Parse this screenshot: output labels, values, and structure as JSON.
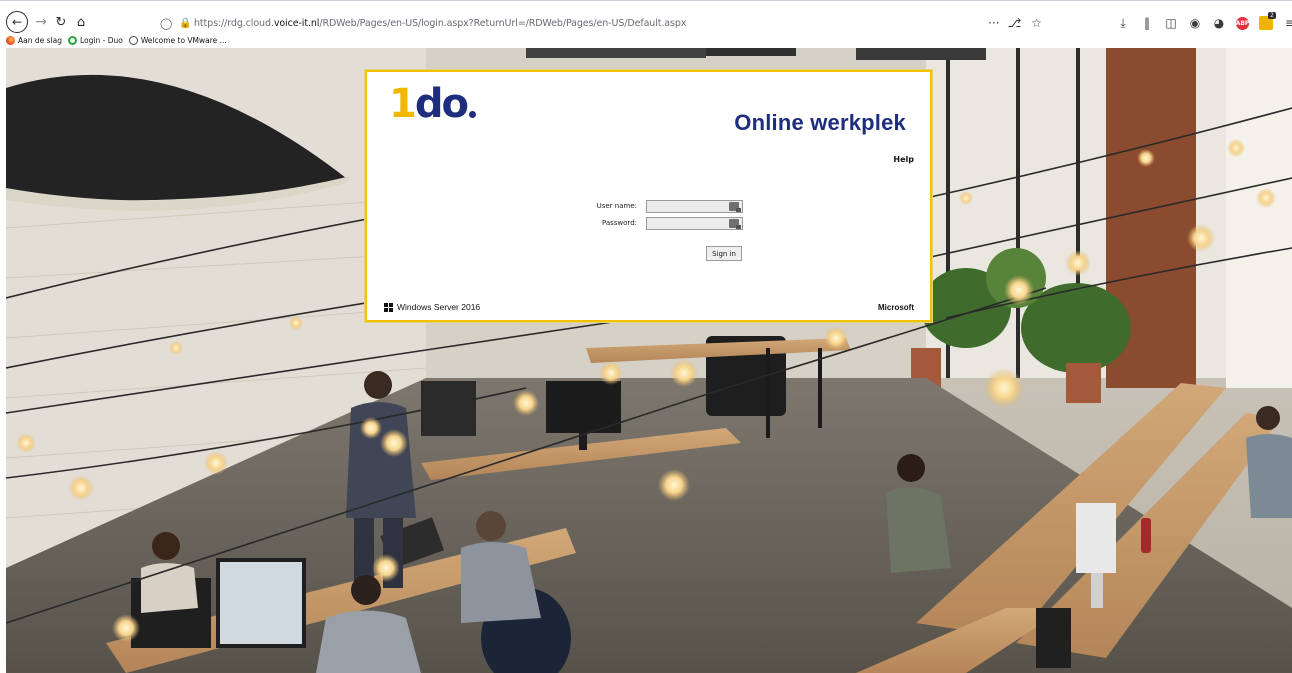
{
  "browser": {
    "url_prefix": "https://rdg.cloud.",
    "url_domain": "voice-it.nl",
    "url_suffix": "/RDWeb/Pages/en-US/login.aspx?ReturnUrl=/RDWeb/Pages/en-US/Default.aspx",
    "page_actions": "···",
    "extension_badge": "2",
    "adblock_label": "ABP",
    "bookmarks": [
      {
        "label": "Aan de slag"
      },
      {
        "label": "Login - Duo"
      },
      {
        "label": "Welcome to VMware ..."
      }
    ]
  },
  "login": {
    "logo_one": "1",
    "logo_rest": "do",
    "title": "Online werkplek",
    "help": "Help",
    "username_label": "User name:",
    "username_value": "",
    "password_label": "Password:",
    "password_value": "",
    "signin_label": "Sign in",
    "product": "Windows Server 2016",
    "vendor": "Microsoft"
  },
  "colors": {
    "brand_blue": "#1e2d7d",
    "brand_yellow": "#f2b800",
    "card_border": "#f2c200"
  }
}
